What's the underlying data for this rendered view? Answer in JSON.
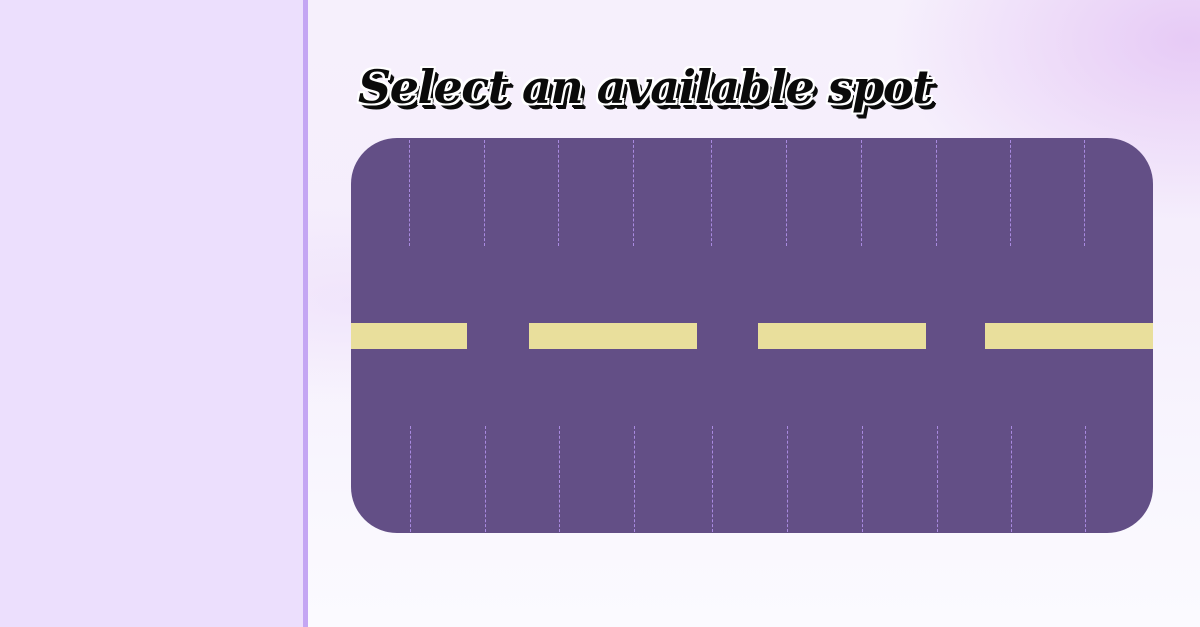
{
  "page": {
    "title": "Select an available spot"
  },
  "colors": {
    "sidebar_bg": "#ecdffd",
    "sidebar_border": "#c4a6f3",
    "lot_surface": "#634f86",
    "spot_divider": "#a98ae0",
    "center_line": "#e9df9c",
    "title_text": "#0a0a0a"
  },
  "parking_lot": {
    "rows": [
      "top",
      "bottom"
    ],
    "spots_per_row": 10
  }
}
